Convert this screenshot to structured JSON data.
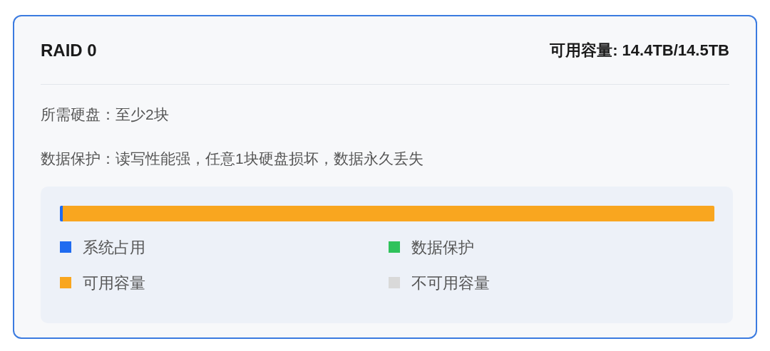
{
  "card": {
    "title": "RAID 0",
    "capacity_label": "可用容量:",
    "capacity_value": "14.4TB/14.5TB",
    "selected": true
  },
  "details": [
    {
      "label": "所需硬盘：",
      "value": "至少2块"
    },
    {
      "label": "数据保护：",
      "value": "读写性能强，任意1块硬盘损坏，数据永久丢失"
    }
  ],
  "usage_bar": {
    "segments": [
      {
        "color": "#1f6bf0",
        "level": 0.004
      },
      {
        "color": "#f9a61f",
        "level": 0.996
      }
    ]
  },
  "legend": [
    {
      "label": "系统占用",
      "color": "#1f6bf0"
    },
    {
      "label": "数据保护",
      "color": "#2fc25b"
    },
    {
      "label": "可用容量",
      "color": "#f9a61f"
    },
    {
      "label": "不可用容量",
      "color": "#d9d9d9"
    }
  ]
}
